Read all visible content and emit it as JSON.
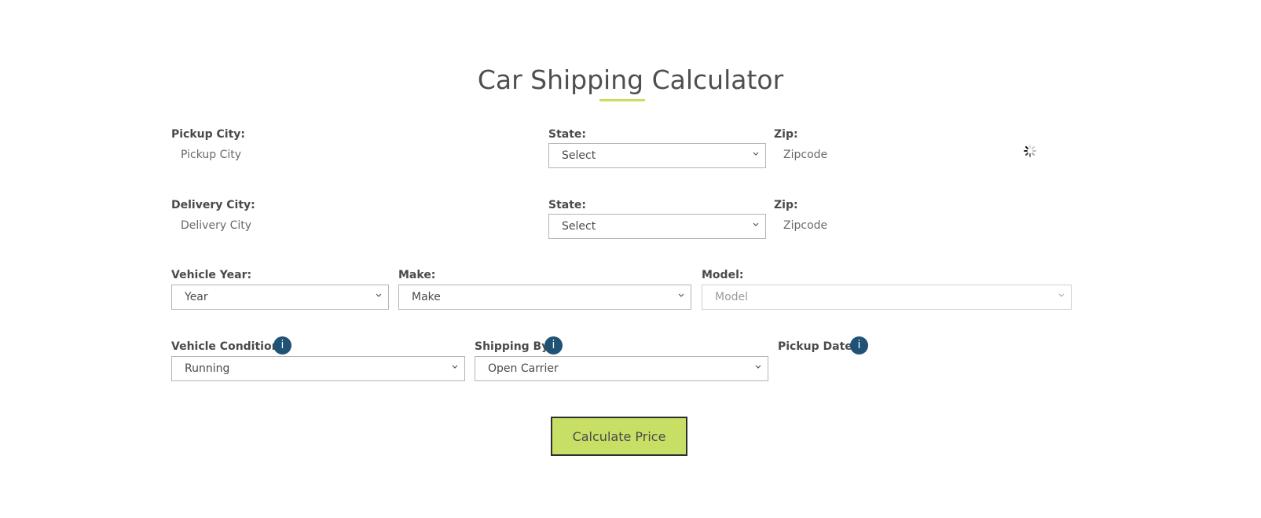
{
  "header": {
    "title": "Car Shipping Calculator"
  },
  "pickup": {
    "city_label": "Pickup City:",
    "city_placeholder": "Pickup City",
    "state_label": "State:",
    "state_value": "Select",
    "zip_label": "Zip:",
    "zip_placeholder": "Zipcode"
  },
  "delivery": {
    "city_label": "Delivery City:",
    "city_placeholder": "Delivery City",
    "state_label": "State:",
    "state_value": "Select",
    "zip_label": "Zip:",
    "zip_placeholder": "Zipcode"
  },
  "vehicle": {
    "year_label": "Vehicle Year:",
    "year_value": "Year",
    "make_label": "Make:",
    "make_value": "Make",
    "model_label": "Model:",
    "model_value": "Model"
  },
  "options": {
    "condition_label": "Vehicle Condition:",
    "condition_value": "Running",
    "shipping_label": "Shipping By:",
    "shipping_value": "Open Carrier",
    "pickup_date_label": "Pickup Date:",
    "info_glyph": "i"
  },
  "actions": {
    "calculate_label": "Calculate Price"
  },
  "colors": {
    "accent": "#c8df66",
    "info": "#1f5274",
    "text": "#4a4a4a"
  }
}
